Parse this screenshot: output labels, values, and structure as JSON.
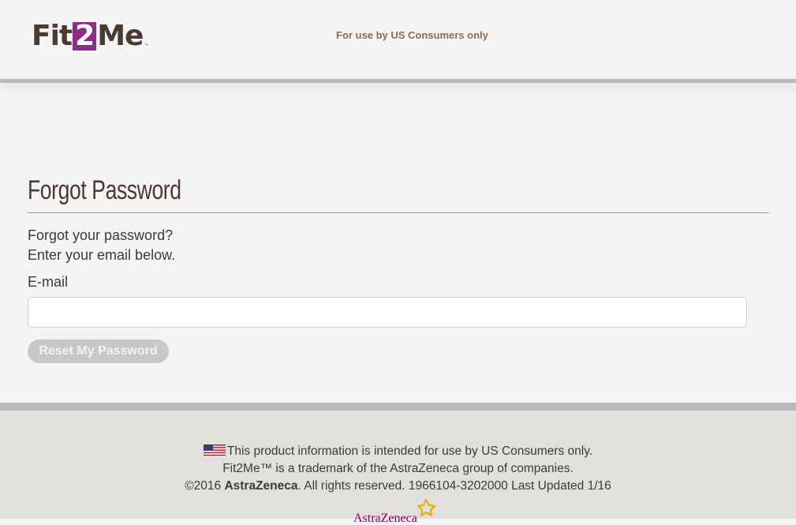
{
  "header": {
    "logo_prefix": "Fit",
    "logo_box": "2",
    "logo_suffix": "Me",
    "logo_tm": "™",
    "note": "For use by US Consumers only"
  },
  "main": {
    "title": "Forgot Password",
    "intro_line1": "Forgot your password?",
    "intro_line2": "Enter your email below.",
    "email_label": "E-mail",
    "email_value": "",
    "email_placeholder": "",
    "reset_button_label": "Reset My Password"
  },
  "footer": {
    "line1": "This product information is intended for use by US Consumers only.",
    "line2": "Fit2Me™ is a trademark of the AstraZeneca group of companies.",
    "line3_prefix": "©2016 ",
    "line3_brand": "AstraZeneca",
    "line3_suffix": ". All rights reserved. 1966104-3202000 Last Updated 1/16",
    "brand_logo_text": "AstraZeneca"
  },
  "icons": {
    "flag": "us-flag-icon",
    "brand_mark": "astrazeneca-symbol-icon"
  },
  "colors": {
    "brand_purple": "#8e2c8a",
    "brand_brown": "#4a3a32",
    "az_magenta": "#830051",
    "az_gold": "#f0ab00",
    "button_disabled": "#c8c8c8"
  }
}
